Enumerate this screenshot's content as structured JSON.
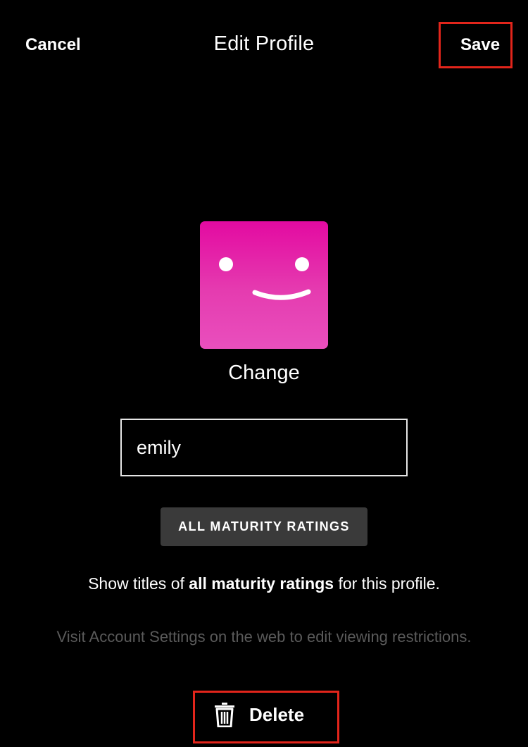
{
  "header": {
    "cancel_label": "Cancel",
    "title": "Edit Profile",
    "save_label": "Save"
  },
  "avatar": {
    "icon": "smiley-face-icon",
    "color": "#e30aa1",
    "change_label": "Change"
  },
  "profile_name": {
    "value": "emily"
  },
  "maturity": {
    "badge_label": "ALL MATURITY RATINGS",
    "desc_prefix": "Show titles of ",
    "desc_bold": "all maturity ratings",
    "desc_suffix": " for this profile.",
    "note": "Visit Account Settings on the web to edit viewing restrictions."
  },
  "footer": {
    "delete_label": "Delete",
    "delete_icon": "trash-icon"
  },
  "colors": {
    "background": "#000000",
    "highlight": "#e2251b",
    "badge_bg": "#3a3a3a",
    "muted_text": "#5a5a5a"
  }
}
